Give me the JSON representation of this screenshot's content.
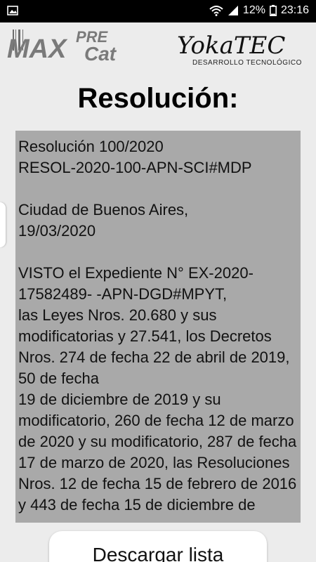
{
  "status_bar": {
    "battery_percent": "12%",
    "time": "23:16",
    "icons": [
      "image-icon",
      "wifi-icon",
      "signal-icon",
      "battery-icon"
    ]
  },
  "logos": {
    "left_brand": [
      "MAX",
      "PRE",
      "Cat"
    ],
    "right_brand": [
      "YokaTEC",
      "DESARROLLO TECNOLÓGICO"
    ]
  },
  "page": {
    "title": "Resolución:"
  },
  "document": {
    "paragraphs": [
      "Resolución 100/2020\nRESOL-2020-100-APN-SCI#MDP",
      "Ciudad de Buenos Aires,\n19/03/2020",
      "VISTO el Expediente N° EX-2020-17582489- -APN-DGD#MPYT,\nlas Leyes Nros. 20.680 y sus modificatorias y 27.541, los Decretos Nros. 274 de fecha 22 de abril de 2019, 50 de fecha\n19 de diciembre de 2019 y su modificatorio, 260 de fecha 12 de marzo de 2020 y su modificatorio, 287 de fecha 17 de marzo de 2020, las Resoluciones Nros. 12 de fecha 15 de febrero de 2016 y 443 de fecha 15 de diciembre de"
    ]
  },
  "actions": {
    "download_label": "Descargar lista"
  }
}
